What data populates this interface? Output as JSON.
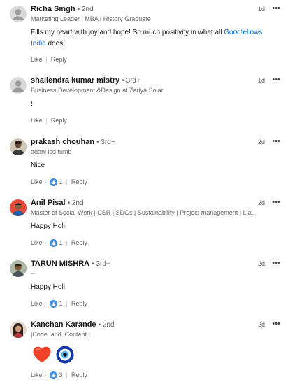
{
  "actions": {
    "like": "Like",
    "reply": "Reply",
    "more": "•••",
    "dot": "·"
  },
  "comments": [
    {
      "name": "Richa Singh",
      "degree": "• 2nd",
      "headline": "Marketing Leader | MBA | History Graduate",
      "time": "1d",
      "text_before": "Fills my heart with joy and hope! So much positivity in what all ",
      "link": "Goodfellows India",
      "text_after": " does."
    },
    {
      "name": "shailendra kumar mistry",
      "degree": "• 3rd+",
      "headline": "Business Development &Design at Zariya Solar",
      "time": "1d",
      "text": "!"
    },
    {
      "name": "prakash chouhan",
      "degree": "• 3rd+",
      "headline": "adani icd tumb",
      "time": "2d",
      "text": "Nice"
    },
    {
      "name": "Anil Pisal",
      "degree": "• 2nd",
      "headline": "Master of Social Work | CSR | SDGs | Sustainability | Project management | Lia...",
      "time": "2d",
      "text": "Happy Holi",
      "likes": "1"
    },
    {
      "name": "TARUN MISHRA",
      "degree": "• 3rd+",
      "headline": "--",
      "time": "2d",
      "text": "Happy Holi",
      "likes": "1"
    },
    {
      "name": "Kanchan Karande",
      "degree": "• 2nd",
      "headline": "|Code |and |Content |",
      "time": "2d",
      "emojis": [
        "heart-emoji",
        "nazar-amulet-emoji"
      ],
      "likes": "3"
    }
  ],
  "likes_on_nice": "1",
  "colors": {
    "link": "#0a66c2",
    "like_badge": "#378fe9",
    "muted": "#666666"
  }
}
